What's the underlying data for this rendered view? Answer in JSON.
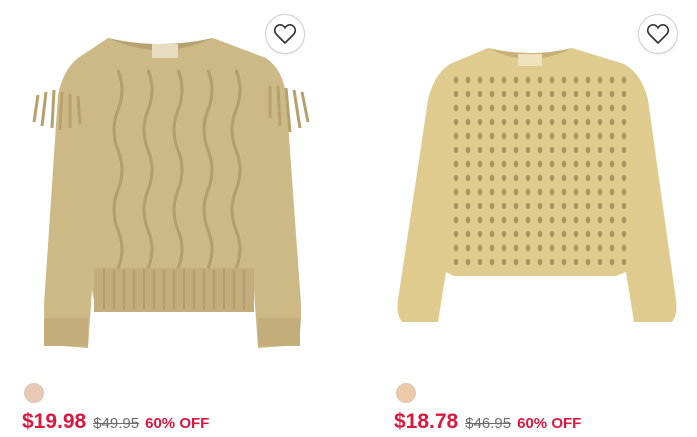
{
  "products": [
    {
      "image_alt": "cable knit fringe sweater",
      "swatch_color": "#e8c9b3",
      "sale_price": "$19.98",
      "original_price": "$49.95",
      "discount": "60% OFF",
      "sweater_color": "#cdb985",
      "sweater_shade": "#b6a270"
    },
    {
      "image_alt": "pointelle knit sweater",
      "swatch_color": "#ecc9a8",
      "sale_price": "$18.78",
      "original_price": "$46.95",
      "discount": "60% OFF",
      "sweater_color": "#e0cb8e",
      "sweater_shade": "#c8b176"
    }
  ],
  "colors": {
    "accent_red": "#d9173f",
    "strike_gray": "#6b6b6b"
  },
  "icons": {
    "favorite": "heart-outline-icon"
  }
}
